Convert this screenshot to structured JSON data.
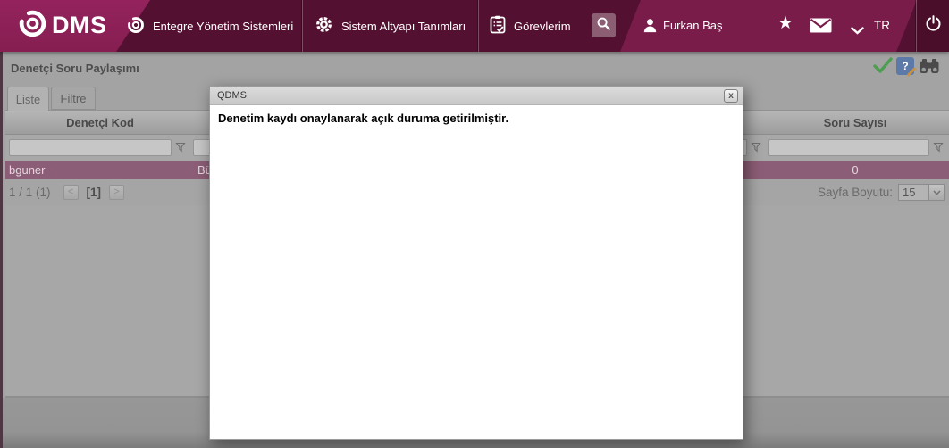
{
  "topbar": {
    "logo": {
      "brand": "QDMS",
      "text": "DMS"
    },
    "menu": [
      {
        "label": "Entegre Yönetim Sistemleri"
      },
      {
        "label": "Sistem Altyapı Tanımları"
      },
      {
        "label": "Görevlerim"
      }
    ],
    "user_name": "Furkan Baş",
    "star_glyph": "★",
    "language": "TR"
  },
  "page": {
    "title": "Denetçi Soru Paylaşımı",
    "tabs": [
      {
        "label": "Liste",
        "active": true
      },
      {
        "label": "Filtre",
        "active": false
      }
    ],
    "table": {
      "columns": [
        "Denetçi Kod",
        "Soru Sayısı"
      ],
      "row": {
        "denetci_kod": "bguner",
        "hidden_col_fragment": "Bü",
        "soru_sayisi": "0"
      }
    },
    "pagination": {
      "info": "1 / 1 (1)",
      "prev": "<",
      "current": "[1]",
      "next": ">",
      "page_size_label": "Sayfa Boyutu:",
      "page_size": "15"
    },
    "toolbar_icons": [
      "approve-check",
      "help-book",
      "binoculars-search"
    ]
  },
  "modal": {
    "title": "QDMS",
    "message": "Denetim kaydı onaylanarak açık duruma getirilmiştir.",
    "close_label": "x"
  },
  "colors": {
    "brand_magenta": "#8e2158",
    "menu_dark": "#541031",
    "user_section": "#7a1c4a",
    "power_section": "#4a0e2a",
    "selected_row": "#8c5d76",
    "check_green": "#4e9e52",
    "help_blue": "#5c79a8"
  }
}
